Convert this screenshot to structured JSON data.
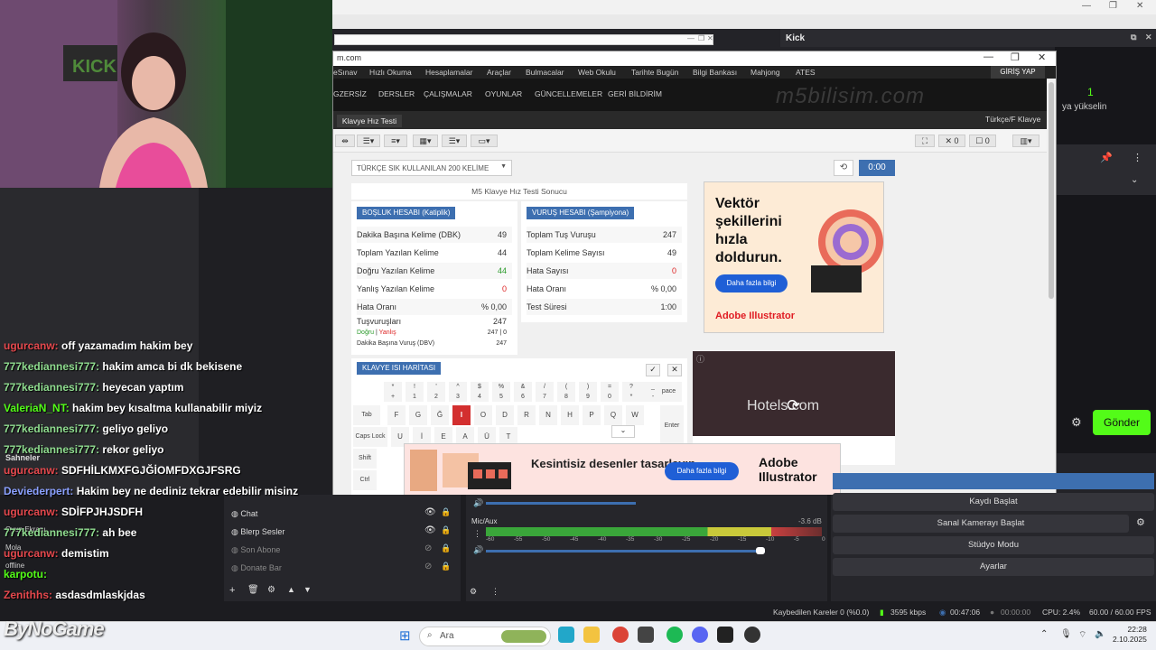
{
  "browser": {
    "url_fragment": "m.com",
    "nav1": [
      "eSınav",
      "Hızlı Okuma",
      "Hesaplamalar",
      "Araçlar",
      "Bulmacalar",
      "Web Okulu",
      "Tarihte Bugün",
      "Bilgi Bankası",
      "Mahjong",
      "ATES"
    ],
    "login": "GİRİŞ YAP",
    "nav2": [
      "GZERSİZ",
      "DERSLER",
      "ÇALIŞMALAR",
      "OYUNLAR",
      "GÜNCELLEMELER",
      "GERİ BİLDİRİM"
    ],
    "watermark": "m5bilisim.com",
    "page_tab": "Klavye Hız Testi",
    "keyboard_type": "Türkçe/F Klavye",
    "toolbar_counts": [
      "0",
      "0"
    ]
  },
  "test": {
    "category": "TÜRKÇE SIK KULLANILAN 200 KELİME",
    "timer": "0:00",
    "result_title": "M5 Klavye Hız Testi Sonucu",
    "bosluk": {
      "header": "BOŞLUK HESABI (Katiplik)",
      "rows": [
        {
          "label": "Dakika Başına Kelime (DBK)",
          "value": "49"
        },
        {
          "label": "Toplam Yazılan Kelime",
          "value": "44"
        },
        {
          "label": "Doğru Yazılan Kelime",
          "value": "44"
        },
        {
          "label": "Yanlış Yazılan Kelime",
          "value": "0"
        },
        {
          "label": "Hata Oranı",
          "value": "% 0,00"
        }
      ],
      "keystrokes_label": "Tuşvuruşları",
      "keystrokes_value": "247",
      "dogru_label": "Doğru",
      "yanlis_label": "Yanlış",
      "dogru_yanlis_value": "247 | 0",
      "dbv_label": "Dakika Başına Vuruş (DBV)",
      "dbv_value": "247"
    },
    "vurus": {
      "header": "VURUŞ HESABI (Şampiyona)",
      "rows": [
        {
          "label": "Toplam Tuş Vuruşu",
          "value": "247"
        },
        {
          "label": "Toplam Kelime Sayısı",
          "value": "49"
        },
        {
          "label": "Hata Sayısı",
          "value": "0"
        },
        {
          "label": "Hata Oranı",
          "value": "% 0,00"
        },
        {
          "label": "Test Süresi",
          "value": "1:00"
        }
      ]
    },
    "keyboard_header": "KLAVYE ISI HARİTASI",
    "keys_row1": [
      "*",
      "!",
      "'",
      "^",
      "$",
      "%",
      "&",
      "/",
      "(",
      ")",
      "=",
      "?",
      "_"
    ],
    "keys_row1_bottom": [
      "+",
      "1",
      "2",
      "3",
      "4",
      "5",
      "6",
      "7",
      "8",
      "9",
      "0",
      "*",
      "-"
    ],
    "backspace": "Backspace",
    "tab": "Tab",
    "keys_row2": [
      "F",
      "G",
      "Ğ",
      "I",
      "O",
      "D",
      "R",
      "N",
      "H",
      "P",
      "Q",
      "W"
    ],
    "enter": "Enter",
    "caps": "Caps Lock",
    "keys_row3": [
      "U",
      "İ",
      "E",
      "A",
      "Ü",
      "T"
    ],
    "shift": "Shift",
    "ctrl": "Ctrl"
  },
  "ads": {
    "ad1_title": "Vektör şekillerini hızla doldurun.",
    "ad1_button": "Daha fazla bilgi",
    "ad1_brand": "Adobe Illustrator",
    "ad2_brand": "Hotels.com",
    "ad3_title": "Kesintisiz desenler tasarlayın.",
    "ad3_button": "Daha fazla bilgi",
    "ad3_brand": "Adobe Illustrator"
  },
  "kick": {
    "title": "Kick",
    "follower_count": "1",
    "follow_text": "ya yükselin",
    "send_button": "Gönder"
  },
  "chat": [
    {
      "user": "ugurcanw:",
      "msg": "off yazamadım hakim bey",
      "color": "r"
    },
    {
      "user": "777kediannesi777:",
      "msg": "hakim amca bi dk bekisene",
      "color": ""
    },
    {
      "user": "777kediannesi777:",
      "msg": "heyecan yaptım",
      "color": ""
    },
    {
      "user": "ValeriaN_NT:",
      "msg": "hakim bey kısaltma kullanabilir miyiz",
      "color": "g"
    },
    {
      "user": "777kediannesi777:",
      "msg": "geliyo geliyo",
      "color": ""
    },
    {
      "user": "777kediannesi777:",
      "msg": "rekor geliyo",
      "color": ""
    },
    {
      "user": "ugurcanw:",
      "msg": "SDFHİLKMXFGJĞİOMFDXGJFSRG",
      "color": "r"
    },
    {
      "user": "Deviederpert:",
      "msg": "Hakim bey ne dediniz tekrar edebilir misinz",
      "color": "b"
    },
    {
      "user": "ugurcanw:",
      "msg": "SDİFPJHJSDFH",
      "color": "r"
    },
    {
      "user": "777kediannesi777:",
      "msg": "ah bee",
      "color": ""
    },
    {
      "user": "ugurcanw:",
      "msg": "demistim",
      "color": "r"
    },
    {
      "user": "karpotu:",
      "msg": "",
      "color": "g"
    },
    {
      "user": "Zenithhs:",
      "msg": "asdasdmlaskjdas",
      "color": "r"
    }
  ],
  "scenes": {
    "label": "Sahneler",
    "items": [
      "Oyun Ekranı",
      "Mola",
      "offline"
    ]
  },
  "sources": [
    {
      "name": "Chat"
    },
    {
      "name": "Blerp Sesler"
    },
    {
      "name": "Son Abone"
    },
    {
      "name": "Donate Bar"
    }
  ],
  "mixer": {
    "mic_label": "Mic/Aux",
    "mic_db": "-3.6 dB",
    "ticks": [
      "-60",
      "-55",
      "-50",
      "-45",
      "-40",
      "-35",
      "-30",
      "-25",
      "-20",
      "-15",
      "-10",
      "-5",
      "0"
    ],
    "volume_level": 0.83
  },
  "controls": [
    "Kaydı Başlat",
    "Sanal Kamerayı Başlat",
    "Stüdyo Modu",
    "Ayarlar"
  ],
  "status": {
    "dropped": "Kaybedilen Kareler 0 (%0.0)",
    "bitrate": "3595 kbps",
    "live_time": "00:47:06",
    "rec_time": "00:00:00",
    "cpu": "CPU: 2.4%",
    "fps": "60.00 / 60.00 FPS"
  },
  "taskbar": {
    "search": "Ara",
    "time": "22:28",
    "date": "2.10.2025"
  },
  "overlay_brand": "ByNoGame",
  "colors": {
    "accent": "#3d6fb0",
    "kick_green": "#53fc18",
    "error_red": "#d32f2f"
  }
}
